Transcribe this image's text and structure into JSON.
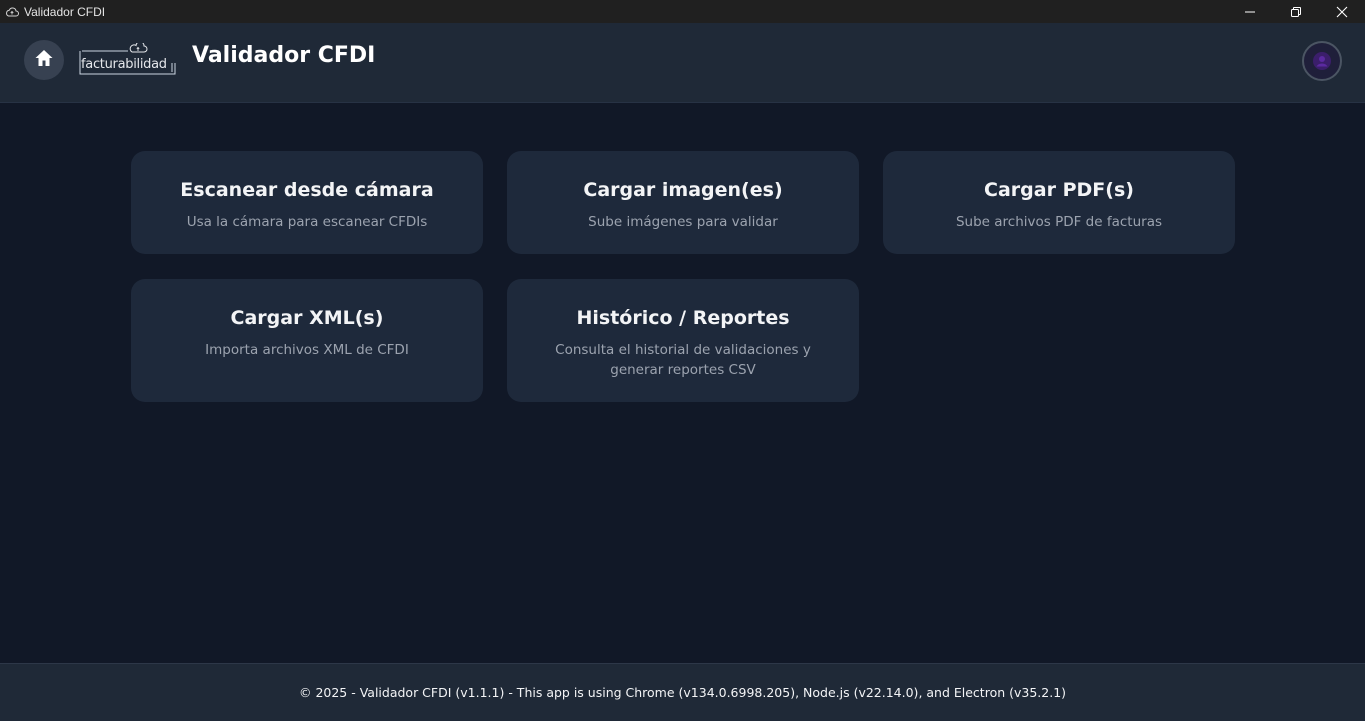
{
  "window": {
    "title": "Validador CFDI",
    "icon": "cloud-icon",
    "controls": [
      "minimize-icon",
      "restore-icon",
      "close-icon"
    ]
  },
  "header": {
    "home_icon": "home-icon",
    "logo_text": "facturabilidad",
    "title": "Validador CFDI",
    "avatar_icon": "user-avatar"
  },
  "cards": [
    {
      "title": "Escanear desde cámara",
      "description": "Usa la cámara para escanear CFDIs"
    },
    {
      "title": "Cargar imagen(es)",
      "description": "Sube imágenes para validar"
    },
    {
      "title": "Cargar PDF(s)",
      "description": "Sube archivos PDF de facturas"
    },
    {
      "title": "Cargar XML(s)",
      "description": "Importa archivos XML de CFDI"
    },
    {
      "title": "Histórico / Reportes",
      "description": "Consulta el historial de validaciones y generar reportes CSV"
    }
  ],
  "footer": {
    "text": "© 2025 - Validador CFDI (v1.1.1) - This app is using Chrome (v134.0.6998.205), Node.js (v22.14.0), and Electron (v35.2.1)"
  },
  "colors": {
    "background": "#111827",
    "header": "#1f2937",
    "card": "#1e293b",
    "text_primary": "#f3f4f6",
    "text_secondary": "#9ca3af"
  }
}
